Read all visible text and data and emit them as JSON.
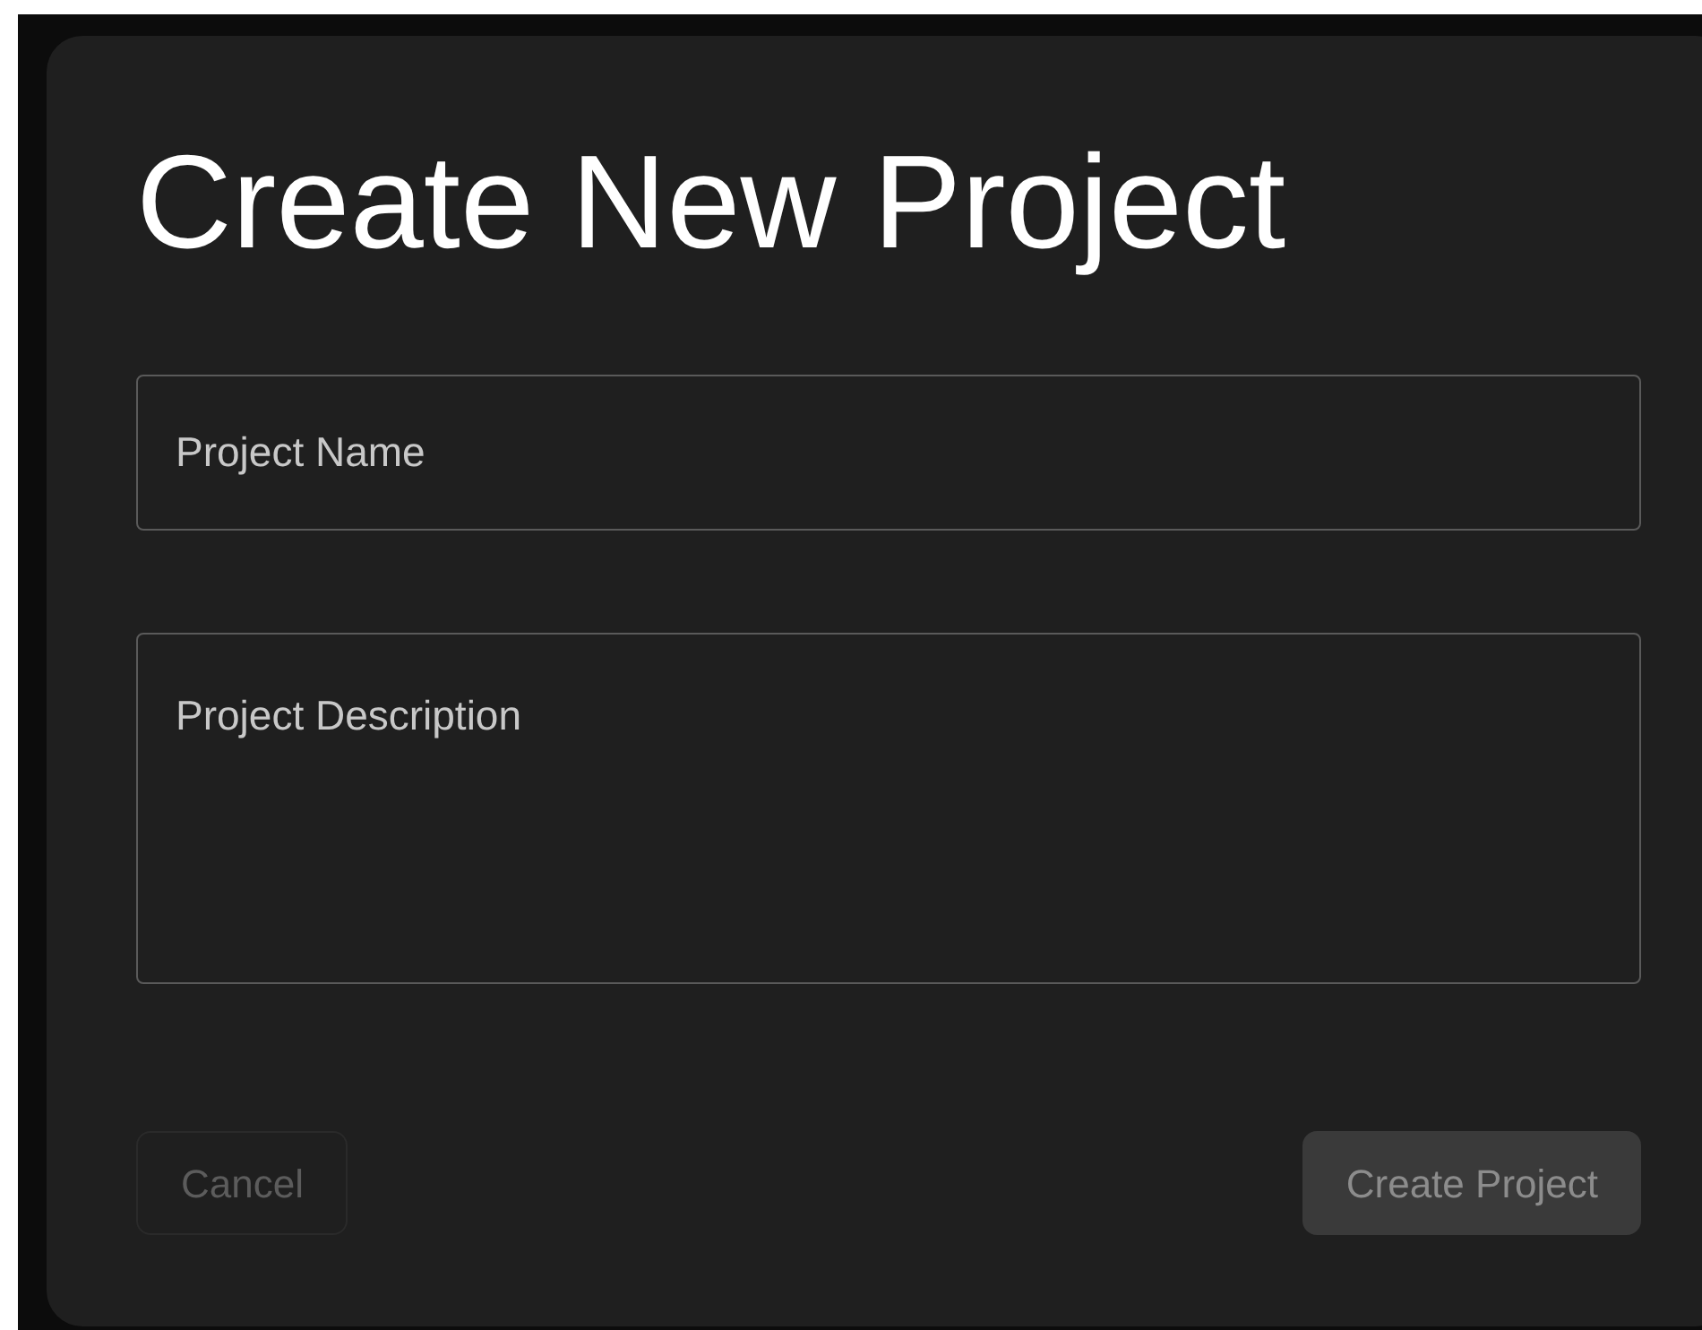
{
  "title": "Create New Project",
  "fields": [
    {
      "kind": "input",
      "placeholder": "Project Name"
    },
    {
      "kind": "textarea",
      "placeholder": "Project Description"
    }
  ],
  "buttons": [
    {
      "kind": "secondary",
      "label": "Cancel",
      "disabled": true
    },
    {
      "kind": "primary",
      "label": "Create Project",
      "disabled": true
    }
  ]
}
